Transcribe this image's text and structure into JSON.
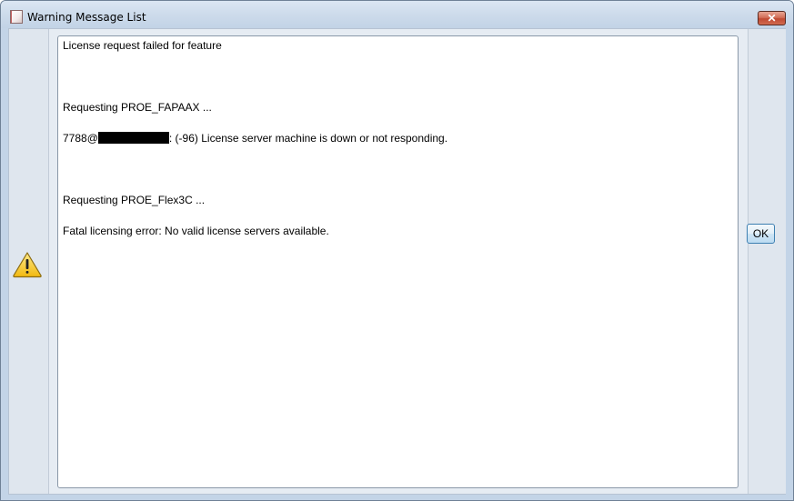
{
  "window": {
    "title": "Warning Message List",
    "close_label": "✕"
  },
  "messages": {
    "line1": "License request failed for feature",
    "line2": "Requesting PROE_FAPAAX ...",
    "line3_prefix": "7788@",
    "line3_suffix": ": (-96) License server machine is down or not responding.",
    "line4": "Requesting PROE_Flex3C ...",
    "line5": "Fatal licensing error: No valid license servers available."
  },
  "buttons": {
    "ok_label": "OK"
  },
  "icons": {
    "app": "app-icon",
    "warning": "warning-icon",
    "close": "close-icon"
  },
  "colors": {
    "warning_fill": "#f5c61f",
    "close_button": "#c84a33"
  }
}
